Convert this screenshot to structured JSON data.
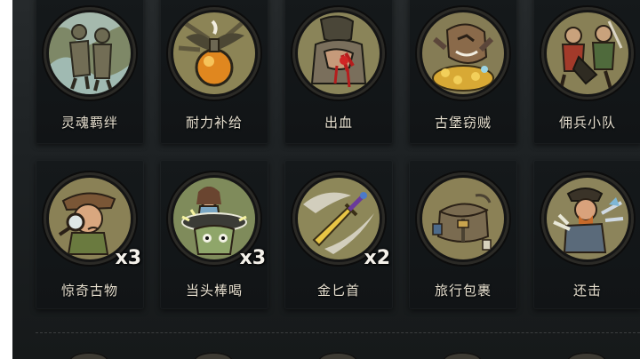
{
  "cards": [
    {
      "id": "soul-bond",
      "label": "灵魂羁绊",
      "count": "",
      "icon": "soul-bond-icon",
      "bg": "#7e8867"
    },
    {
      "id": "endurance-supply",
      "label": "耐力补给",
      "count": "",
      "icon": "endurance-supply-icon",
      "bg": "#8c8456"
    },
    {
      "id": "bleed",
      "label": "出血",
      "count": "",
      "icon": "bleed-icon",
      "bg": "#8a8459"
    },
    {
      "id": "castle-thief",
      "label": "古堡窃贼",
      "count": "",
      "icon": "castle-thief-icon",
      "bg": "#857c55"
    },
    {
      "id": "mercenary-squad",
      "label": "佣兵小队",
      "count": "",
      "icon": "mercenary-squad-icon",
      "bg": "#888056"
    },
    {
      "id": "curious-antique",
      "label": "惊奇古物",
      "count": "x3",
      "icon": "curious-antique-icon",
      "bg": "#8a8156"
    },
    {
      "id": "head-blow",
      "label": "当头棒喝",
      "count": "x3",
      "icon": "head-blow-icon",
      "bg": "#7f8b5b"
    },
    {
      "id": "golden-dagger",
      "label": "金匕首",
      "count": "x2",
      "icon": "golden-dagger-icon",
      "bg": "#8d8759"
    },
    {
      "id": "travel-pack",
      "label": "旅行包裹",
      "count": "",
      "icon": "travel-pack-icon",
      "bg": "#8b8156"
    },
    {
      "id": "counterattack",
      "label": "还击",
      "count": "",
      "icon": "counterattack-icon",
      "bg": "#8c845b"
    }
  ]
}
